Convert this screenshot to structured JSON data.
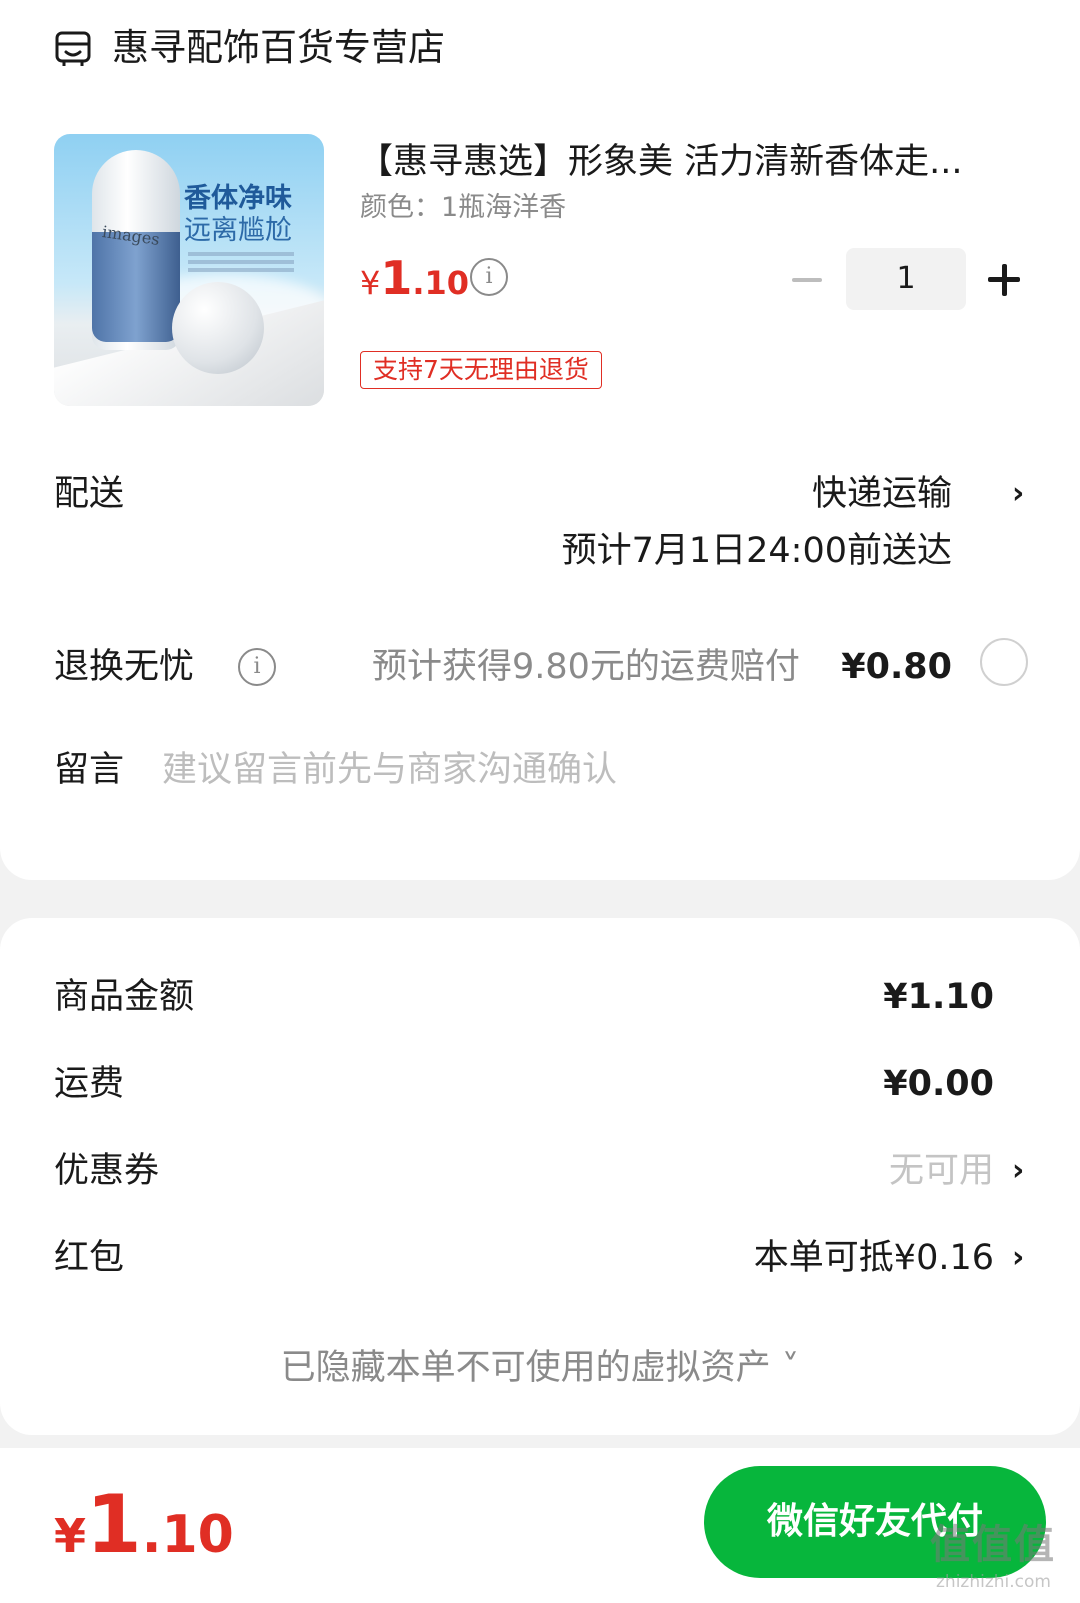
{
  "store": {
    "name": "惠寻配饰百货专营店",
    "icon": "store-icon"
  },
  "product": {
    "image_text_1": "香体净味",
    "image_text_2": "远离尴尬",
    "image_brand": "images",
    "title": "【惠寻惠选】形象美 活力清新香体走...",
    "spec": "颜色：1瓶海洋香",
    "price_currency": "¥",
    "price_int": "1",
    "price_dec": ".10",
    "quantity": "1",
    "badge": "支持7天无理由退货"
  },
  "shipping": {
    "label": "配送",
    "method": "快递运输",
    "eta": "预计7月1日24:00前送达"
  },
  "returns": {
    "label": "退换无忧",
    "desc": "预计获得9.80元的运费赔付",
    "price": "¥0.80"
  },
  "message": {
    "label": "留言",
    "placeholder": "建议留言前先与商家沟通确认"
  },
  "summary": {
    "goods_label": "商品金额",
    "goods_value": "¥1.10",
    "freight_label": "运费",
    "freight_value": "¥0.00",
    "coupon_label": "优惠券",
    "coupon_value": "无可用",
    "redpacket_label": "红包",
    "redpacket_value": "本单可抵¥0.16",
    "hidden_assets": "已隐藏本单不可使用的虚拟资产 ˅"
  },
  "footer": {
    "total_currency": "¥",
    "total_int": "1",
    "total_dec": ".10",
    "pay_button": "微信好友代付",
    "watermark": "值值值",
    "watermark_sub": "zhizhizhi.com"
  },
  "colors": {
    "accent_red": "#e02e24",
    "wechat_green": "#07b63c"
  }
}
